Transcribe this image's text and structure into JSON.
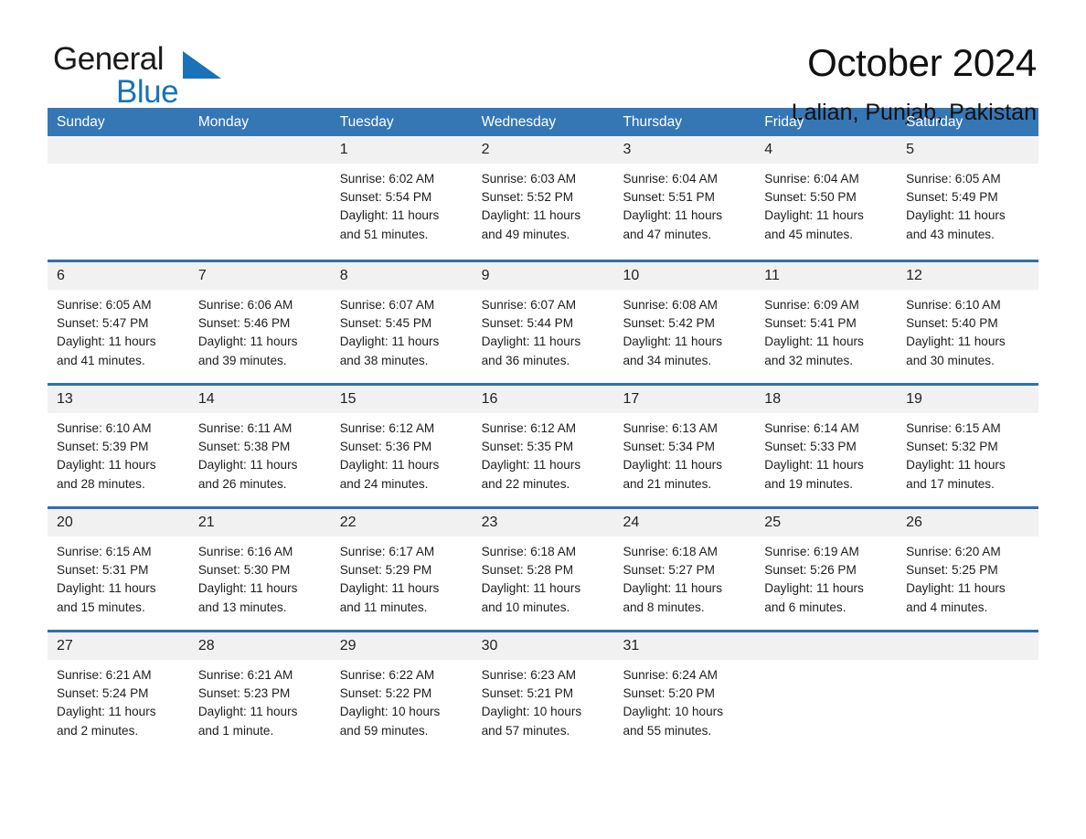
{
  "brand": {
    "name_part1": "General",
    "name_part2": "Blue",
    "logo_icon": "triangle-flag-icon",
    "accent_color": "#1a72b8"
  },
  "header": {
    "month_title": "October 2024",
    "location": "Lalian, Punjab, Pakistan"
  },
  "calendar": {
    "header_bg": "#3577b5",
    "row_divider_color": "#2f6fad",
    "day_band_bg": "#f1f1f1",
    "weekdays": [
      "Sunday",
      "Monday",
      "Tuesday",
      "Wednesday",
      "Thursday",
      "Friday",
      "Saturday"
    ],
    "weeks": [
      [
        {
          "empty": true
        },
        {
          "empty": true
        },
        {
          "day": "1",
          "sunrise": "Sunrise: 6:02 AM",
          "sunset": "Sunset: 5:54 PM",
          "daylight_line1": "Daylight: 11 hours",
          "daylight_line2": "and 51 minutes."
        },
        {
          "day": "2",
          "sunrise": "Sunrise: 6:03 AM",
          "sunset": "Sunset: 5:52 PM",
          "daylight_line1": "Daylight: 11 hours",
          "daylight_line2": "and 49 minutes."
        },
        {
          "day": "3",
          "sunrise": "Sunrise: 6:04 AM",
          "sunset": "Sunset: 5:51 PM",
          "daylight_line1": "Daylight: 11 hours",
          "daylight_line2": "and 47 minutes."
        },
        {
          "day": "4",
          "sunrise": "Sunrise: 6:04 AM",
          "sunset": "Sunset: 5:50 PM",
          "daylight_line1": "Daylight: 11 hours",
          "daylight_line2": "and 45 minutes."
        },
        {
          "day": "5",
          "sunrise": "Sunrise: 6:05 AM",
          "sunset": "Sunset: 5:49 PM",
          "daylight_line1": "Daylight: 11 hours",
          "daylight_line2": "and 43 minutes."
        }
      ],
      [
        {
          "day": "6",
          "sunrise": "Sunrise: 6:05 AM",
          "sunset": "Sunset: 5:47 PM",
          "daylight_line1": "Daylight: 11 hours",
          "daylight_line2": "and 41 minutes."
        },
        {
          "day": "7",
          "sunrise": "Sunrise: 6:06 AM",
          "sunset": "Sunset: 5:46 PM",
          "daylight_line1": "Daylight: 11 hours",
          "daylight_line2": "and 39 minutes."
        },
        {
          "day": "8",
          "sunrise": "Sunrise: 6:07 AM",
          "sunset": "Sunset: 5:45 PM",
          "daylight_line1": "Daylight: 11 hours",
          "daylight_line2": "and 38 minutes."
        },
        {
          "day": "9",
          "sunrise": "Sunrise: 6:07 AM",
          "sunset": "Sunset: 5:44 PM",
          "daylight_line1": "Daylight: 11 hours",
          "daylight_line2": "and 36 minutes."
        },
        {
          "day": "10",
          "sunrise": "Sunrise: 6:08 AM",
          "sunset": "Sunset: 5:42 PM",
          "daylight_line1": "Daylight: 11 hours",
          "daylight_line2": "and 34 minutes."
        },
        {
          "day": "11",
          "sunrise": "Sunrise: 6:09 AM",
          "sunset": "Sunset: 5:41 PM",
          "daylight_line1": "Daylight: 11 hours",
          "daylight_line2": "and 32 minutes."
        },
        {
          "day": "12",
          "sunrise": "Sunrise: 6:10 AM",
          "sunset": "Sunset: 5:40 PM",
          "daylight_line1": "Daylight: 11 hours",
          "daylight_line2": "and 30 minutes."
        }
      ],
      [
        {
          "day": "13",
          "sunrise": "Sunrise: 6:10 AM",
          "sunset": "Sunset: 5:39 PM",
          "daylight_line1": "Daylight: 11 hours",
          "daylight_line2": "and 28 minutes."
        },
        {
          "day": "14",
          "sunrise": "Sunrise: 6:11 AM",
          "sunset": "Sunset: 5:38 PM",
          "daylight_line1": "Daylight: 11 hours",
          "daylight_line2": "and 26 minutes."
        },
        {
          "day": "15",
          "sunrise": "Sunrise: 6:12 AM",
          "sunset": "Sunset: 5:36 PM",
          "daylight_line1": "Daylight: 11 hours",
          "daylight_line2": "and 24 minutes."
        },
        {
          "day": "16",
          "sunrise": "Sunrise: 6:12 AM",
          "sunset": "Sunset: 5:35 PM",
          "daylight_line1": "Daylight: 11 hours",
          "daylight_line2": "and 22 minutes."
        },
        {
          "day": "17",
          "sunrise": "Sunrise: 6:13 AM",
          "sunset": "Sunset: 5:34 PM",
          "daylight_line1": "Daylight: 11 hours",
          "daylight_line2": "and 21 minutes."
        },
        {
          "day": "18",
          "sunrise": "Sunrise: 6:14 AM",
          "sunset": "Sunset: 5:33 PM",
          "daylight_line1": "Daylight: 11 hours",
          "daylight_line2": "and 19 minutes."
        },
        {
          "day": "19",
          "sunrise": "Sunrise: 6:15 AM",
          "sunset": "Sunset: 5:32 PM",
          "daylight_line1": "Daylight: 11 hours",
          "daylight_line2": "and 17 minutes."
        }
      ],
      [
        {
          "day": "20",
          "sunrise": "Sunrise: 6:15 AM",
          "sunset": "Sunset: 5:31 PM",
          "daylight_line1": "Daylight: 11 hours",
          "daylight_line2": "and 15 minutes."
        },
        {
          "day": "21",
          "sunrise": "Sunrise: 6:16 AM",
          "sunset": "Sunset: 5:30 PM",
          "daylight_line1": "Daylight: 11 hours",
          "daylight_line2": "and 13 minutes."
        },
        {
          "day": "22",
          "sunrise": "Sunrise: 6:17 AM",
          "sunset": "Sunset: 5:29 PM",
          "daylight_line1": "Daylight: 11 hours",
          "daylight_line2": "and 11 minutes."
        },
        {
          "day": "23",
          "sunrise": "Sunrise: 6:18 AM",
          "sunset": "Sunset: 5:28 PM",
          "daylight_line1": "Daylight: 11 hours",
          "daylight_line2": "and 10 minutes."
        },
        {
          "day": "24",
          "sunrise": "Sunrise: 6:18 AM",
          "sunset": "Sunset: 5:27 PM",
          "daylight_line1": "Daylight: 11 hours",
          "daylight_line2": "and 8 minutes."
        },
        {
          "day": "25",
          "sunrise": "Sunrise: 6:19 AM",
          "sunset": "Sunset: 5:26 PM",
          "daylight_line1": "Daylight: 11 hours",
          "daylight_line2": "and 6 minutes."
        },
        {
          "day": "26",
          "sunrise": "Sunrise: 6:20 AM",
          "sunset": "Sunset: 5:25 PM",
          "daylight_line1": "Daylight: 11 hours",
          "daylight_line2": "and 4 minutes."
        }
      ],
      [
        {
          "day": "27",
          "sunrise": "Sunrise: 6:21 AM",
          "sunset": "Sunset: 5:24 PM",
          "daylight_line1": "Daylight: 11 hours",
          "daylight_line2": "and 2 minutes."
        },
        {
          "day": "28",
          "sunrise": "Sunrise: 6:21 AM",
          "sunset": "Sunset: 5:23 PM",
          "daylight_line1": "Daylight: 11 hours",
          "daylight_line2": "and 1 minute."
        },
        {
          "day": "29",
          "sunrise": "Sunrise: 6:22 AM",
          "sunset": "Sunset: 5:22 PM",
          "daylight_line1": "Daylight: 10 hours",
          "daylight_line2": "and 59 minutes."
        },
        {
          "day": "30",
          "sunrise": "Sunrise: 6:23 AM",
          "sunset": "Sunset: 5:21 PM",
          "daylight_line1": "Daylight: 10 hours",
          "daylight_line2": "and 57 minutes."
        },
        {
          "day": "31",
          "sunrise": "Sunrise: 6:24 AM",
          "sunset": "Sunset: 5:20 PM",
          "daylight_line1": "Daylight: 10 hours",
          "daylight_line2": "and 55 minutes."
        },
        {
          "empty": true
        },
        {
          "empty": true
        }
      ]
    ]
  }
}
